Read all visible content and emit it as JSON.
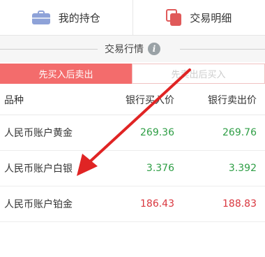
{
  "tabs": [
    {
      "label": "我的持仓",
      "icon": "briefcase-icon"
    },
    {
      "label": "交易明细",
      "icon": "documents-icon"
    }
  ],
  "section": {
    "title": "交易行情",
    "info_icon": "i"
  },
  "segment": {
    "active": "先买入后卖出",
    "inactive": "先卖出后买入"
  },
  "table": {
    "headers": [
      "品种",
      "银行买入价",
      "银行卖出价"
    ],
    "rows": [
      {
        "name": "人民币账户黄金",
        "buy": "269.36",
        "sell": "269.76",
        "trend": "up"
      },
      {
        "name": "人民币账户白银",
        "buy": "3.376",
        "sell": "3.392",
        "trend": "up"
      },
      {
        "name": "人民币账户铂金",
        "buy": "186.43",
        "sell": "188.83",
        "trend": "down"
      }
    ]
  },
  "colors": {
    "accent": "#f36c6c",
    "up": "#2e9e45",
    "down": "#d9363e",
    "annotation_arrow": "#e02424"
  }
}
